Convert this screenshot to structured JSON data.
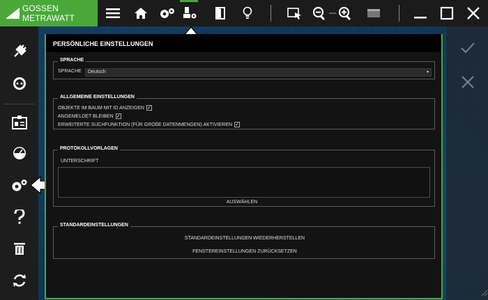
{
  "app": {
    "brand": "GOSSEN METRAWATT",
    "brand_color": "#4aa83a"
  },
  "toolbar": {
    "icons": [
      "menu-icon",
      "home-icon",
      "settings-gears-icon",
      "device-settings-icon",
      "door-exit-icon",
      "lightbulb-icon",
      "select-cursor-icon",
      "zoom-out-icon",
      "zoom-in-icon",
      "display-icon"
    ],
    "window": [
      "minimize-icon",
      "maximize-icon",
      "close-icon"
    ]
  },
  "sidebar": {
    "icons": [
      "plug-icon",
      "socket-icon",
      "id-card-icon",
      "gauge-icon",
      "settings-gears-icon",
      "help-icon",
      "trash-icon",
      "sync-icon"
    ],
    "active_index": 4
  },
  "rightpanel": {
    "icons": [
      "check-icon",
      "cancel-icon"
    ]
  },
  "panel": {
    "title": "PERSÖNLICHE EINSTELLUNGEN",
    "language": {
      "legend": "SPRACHE",
      "label": "SPRACHE",
      "value": "Deutsch"
    },
    "general": {
      "legend": "ALLGEMEINE EINSTELLUNGEN",
      "options": [
        {
          "label": "OBJEKTE IM BAUM MIT ID ANZEIGEN",
          "checked": true
        },
        {
          "label": "ANGEMELDET BLEIBEN",
          "checked": true
        },
        {
          "label": "ERWEITERTE SUCHFUNKTION (FÜR GROßE DATENMENGEN) AKTIVIEREN",
          "checked": true
        }
      ]
    },
    "templates": {
      "legend": "PROTOKOLLVORLAGEN",
      "signature_label": "UNTERSCHRIFT",
      "select_button": "AUSWÄHLEN"
    },
    "defaults": {
      "legend": "STANDARDEINSTELLUNGEN",
      "restore_button": "STANDARDEINSTELLUNGEN WIEDERHERSTELLEN",
      "reset_window_button": "FENSTEREINSTELLUNGEN ZURÜCKSETZEN"
    }
  }
}
